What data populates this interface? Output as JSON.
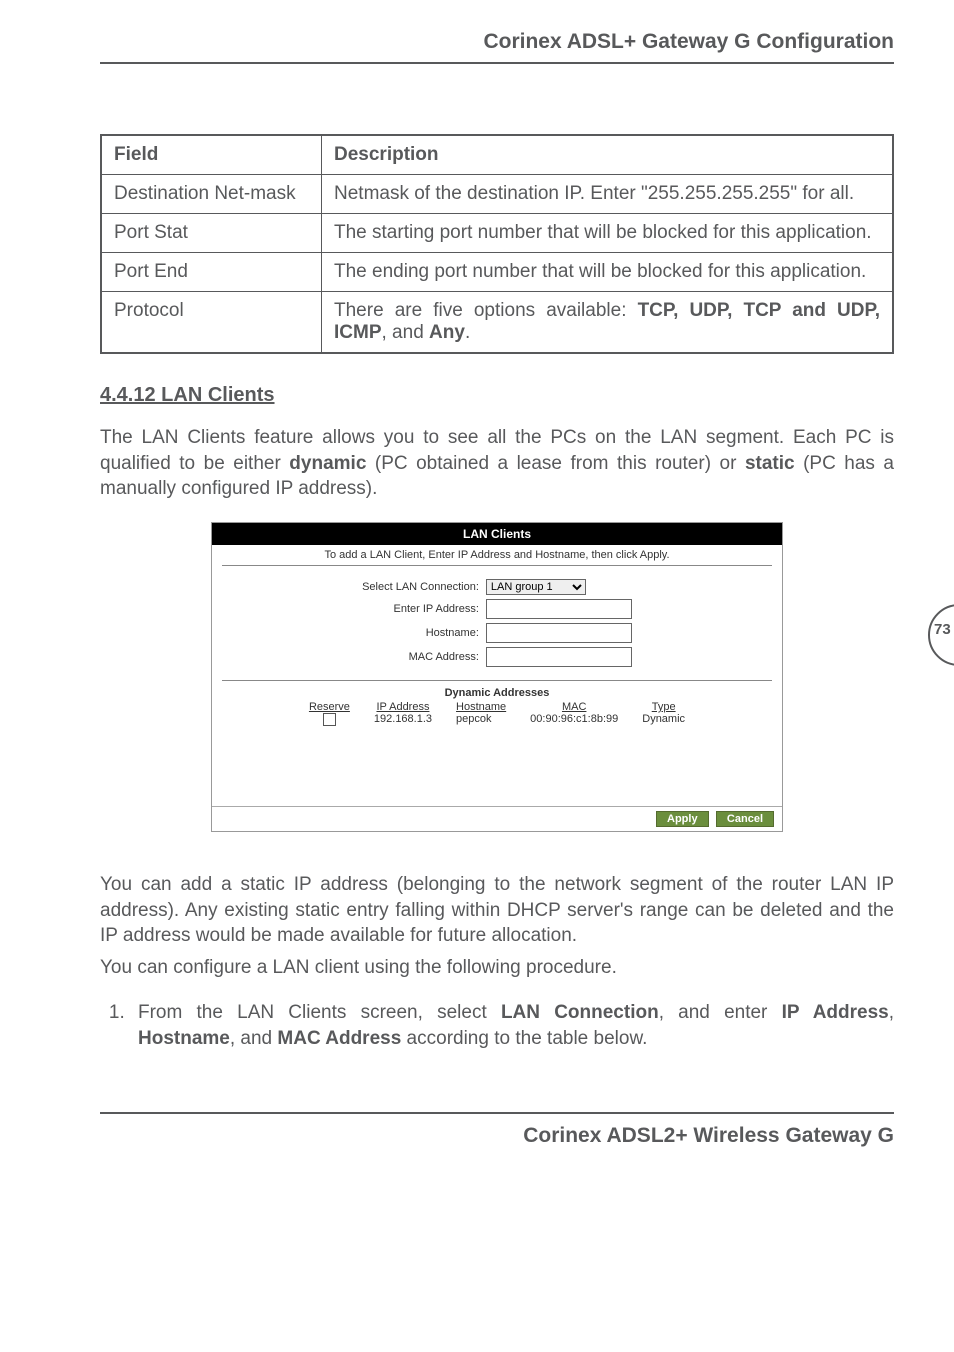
{
  "header": {
    "title": "Corinex ADSL+ Gateway G Configuration"
  },
  "table": {
    "head": {
      "field": "Field",
      "description": "Description"
    },
    "rows": [
      {
        "field": "Destination Net-mask",
        "description": "Netmask of the destination IP. Enter \"255.255.255.255\" for all."
      },
      {
        "field": "Port Stat",
        "description": "The starting port number that will be blocked for this application."
      },
      {
        "field": "Port End",
        "description": "The ending port number that will be blocked for this application."
      }
    ],
    "protocol": {
      "field": "Protocol",
      "desc_prefix": "There are five options available: ",
      "bold1": "TCP, UDP, TCP and UDP, ICMP",
      "mid": ", and ",
      "bold2": "Any",
      "suffix": "."
    }
  },
  "section": {
    "heading": "4.4.12  LAN Clients"
  },
  "intro": {
    "pre": "The LAN Clients feature allows you to see all the PCs on the LAN segment. Each PC is qualified to be either ",
    "b1": "dynamic",
    "mid1": " (PC obtained a lease from this router) or ",
    "b2": "static",
    "post": " (PC has a manually configured IP address)."
  },
  "lan": {
    "title": "LAN Clients",
    "instruction": "To add a LAN Client, Enter IP Address and Hostname, then click Apply.",
    "labels": {
      "select": "Select LAN Connection:",
      "ip": "Enter IP Address:",
      "hostname": "Hostname:",
      "mac": "MAC Address:"
    },
    "select_value": "LAN group 1",
    "dyn_heading": "Dynamic Addresses",
    "columns": {
      "reserve": "Reserve",
      "ip": "IP Address",
      "hostname": "Hostname",
      "mac": "MAC",
      "type": "Type"
    },
    "rows": [
      {
        "ip": "192.168.1.3",
        "hostname": "pepcok",
        "mac": "00:90:96:c1:8b:99",
        "type": "Dynamic"
      }
    ],
    "buttons": {
      "apply": "Apply",
      "cancel": "Cancel"
    }
  },
  "para2": "You can add a static IP address (belonging to the network segment of the router LAN IP address). Any existing static entry falling within DHCP server's range can be deleted and the IP address would be made available for future allocation.",
  "para3": "You can configure a LAN client using the following procedure.",
  "step1": {
    "pre": "From the LAN Clients screen, select ",
    "b1": "LAN Connection",
    "mid1": ", and enter ",
    "b2": "IP Address",
    "mid2": ", ",
    "b3": "Hostname",
    "mid3": ", and ",
    "b4": "MAC Address",
    "post": " according to the table below."
  },
  "footer": {
    "title": "Corinex ADSL2+ Wireless Gateway G"
  },
  "page_number": "73"
}
